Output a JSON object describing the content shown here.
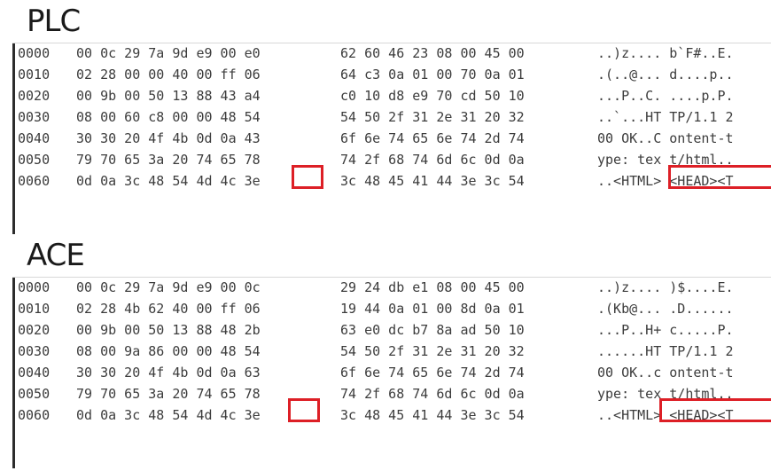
{
  "sections": [
    {
      "id": "plc",
      "title": "PLC",
      "rows": [
        {
          "offset": "0000",
          "hex1": "00 0c 29 7a 9d e9 00 e0",
          "hex2": "62 60 46 23 08 00 45 00",
          "ascii": "..)z.... b`F#..E."
        },
        {
          "offset": "0010",
          "hex1": "02 28 00 00 40 00 ff 06",
          "hex2": "64 c3 0a 01 00 70 0a 01",
          "ascii": ".(..@... d....p.."
        },
        {
          "offset": "0020",
          "hex1": "00 9b 00 50 13 88 43 a4",
          "hex2": "c0 10 d8 e9 70 cd 50 10",
          "ascii": "...P..C. ....p.P."
        },
        {
          "offset": "0030",
          "hex1": "08 00 60 c8 00 00 48 54",
          "hex2": "54 50 2f 31 2e 31 20 32",
          "ascii": "..`...HT TP/1.1 2"
        },
        {
          "offset": "0040",
          "hex1": "30 30 20 4f 4b 0d 0a 43",
          "hex2": "6f 6e 74 65 6e 74 2d 74",
          "ascii": "00 OK..C ontent-t"
        },
        {
          "offset": "0050",
          "hex1": "79 70 65 3a 20 74 65 78",
          "hex2": "74 2f 68 74 6d 6c 0d 0a",
          "ascii": "ype: tex t/html.."
        },
        {
          "offset": "0060",
          "hex1": "0d 0a 3c 48 54 4d 4c 3e",
          "hex2": "3c 48 45 41 44 3e 3c 54",
          "ascii": "..<HTML> <HEAD><T"
        }
      ]
    },
    {
      "id": "ace",
      "title": "ACE",
      "rows": [
        {
          "offset": "0000",
          "hex1": "00 0c 29 7a 9d e9 00 0c",
          "hex2": "29 24 db e1 08 00 45 00",
          "ascii": "..)z.... )$....E."
        },
        {
          "offset": "0010",
          "hex1": "02 28 4b 62 40 00 ff 06",
          "hex2": "19 44 0a 01 00 8d 0a 01",
          "ascii": ".(Kb@... .D......"
        },
        {
          "offset": "0020",
          "hex1": "00 9b 00 50 13 88 48 2b",
          "hex2": "63 e0 dc b7 8a ad 50 10",
          "ascii": "...P..H+ c.....P."
        },
        {
          "offset": "0030",
          "hex1": "08 00 9a 86 00 00 48 54",
          "hex2": "54 50 2f 31 2e 31 20 32",
          "ascii": "......HT TP/1.1 2"
        },
        {
          "offset": "0040",
          "hex1": "30 30 20 4f 4b 0d 0a 63",
          "hex2": "6f 6e 74 65 6e 74 2d 74",
          "ascii": "00 OK..c ontent-t"
        },
        {
          "offset": "0050",
          "hex1": "79 70 65 3a 20 74 65 78",
          "hex2": "74 2f 68 74 6d 6c 0d 0a",
          "ascii": "ype: tex t/html.."
        },
        {
          "offset": "0060",
          "hex1": "0d 0a 3c 48 54 4d 4c 3e",
          "hex2": "3c 48 45 41 44 3e 3c 54",
          "ascii": "..<HTML> <HEAD><T"
        }
      ]
    }
  ],
  "highlight_color": "#dd1f26"
}
